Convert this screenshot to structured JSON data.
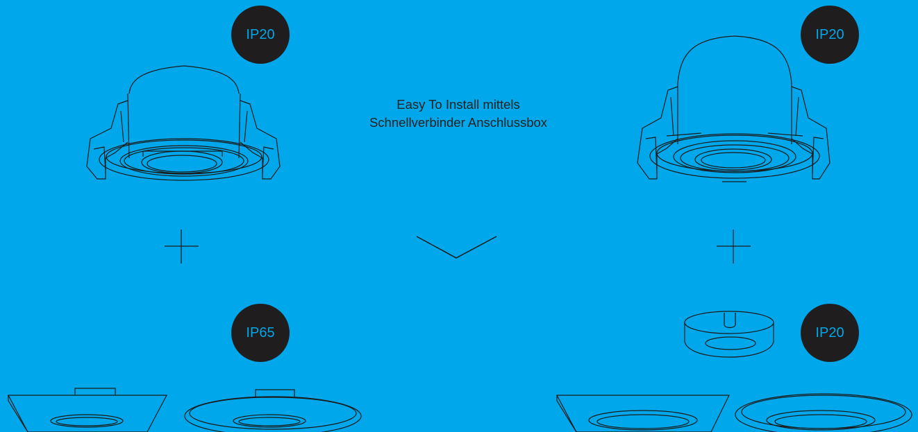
{
  "badges": {
    "top_left": "IP20",
    "top_right": "IP20",
    "bottom_left": "IP65",
    "bottom_right": "IP20"
  },
  "caption": {
    "line1": "Easy To Install mittels",
    "line2": "Schnellverbinder Anschlussbox"
  },
  "colors": {
    "background": "#00a8eb",
    "badge": "#1f1d1e",
    "line": "#1a1a1a"
  },
  "icons": [
    "downlight-illustration",
    "plus-icon",
    "chevron-down-icon",
    "bezel-illustration",
    "connector-box-illustration"
  ]
}
